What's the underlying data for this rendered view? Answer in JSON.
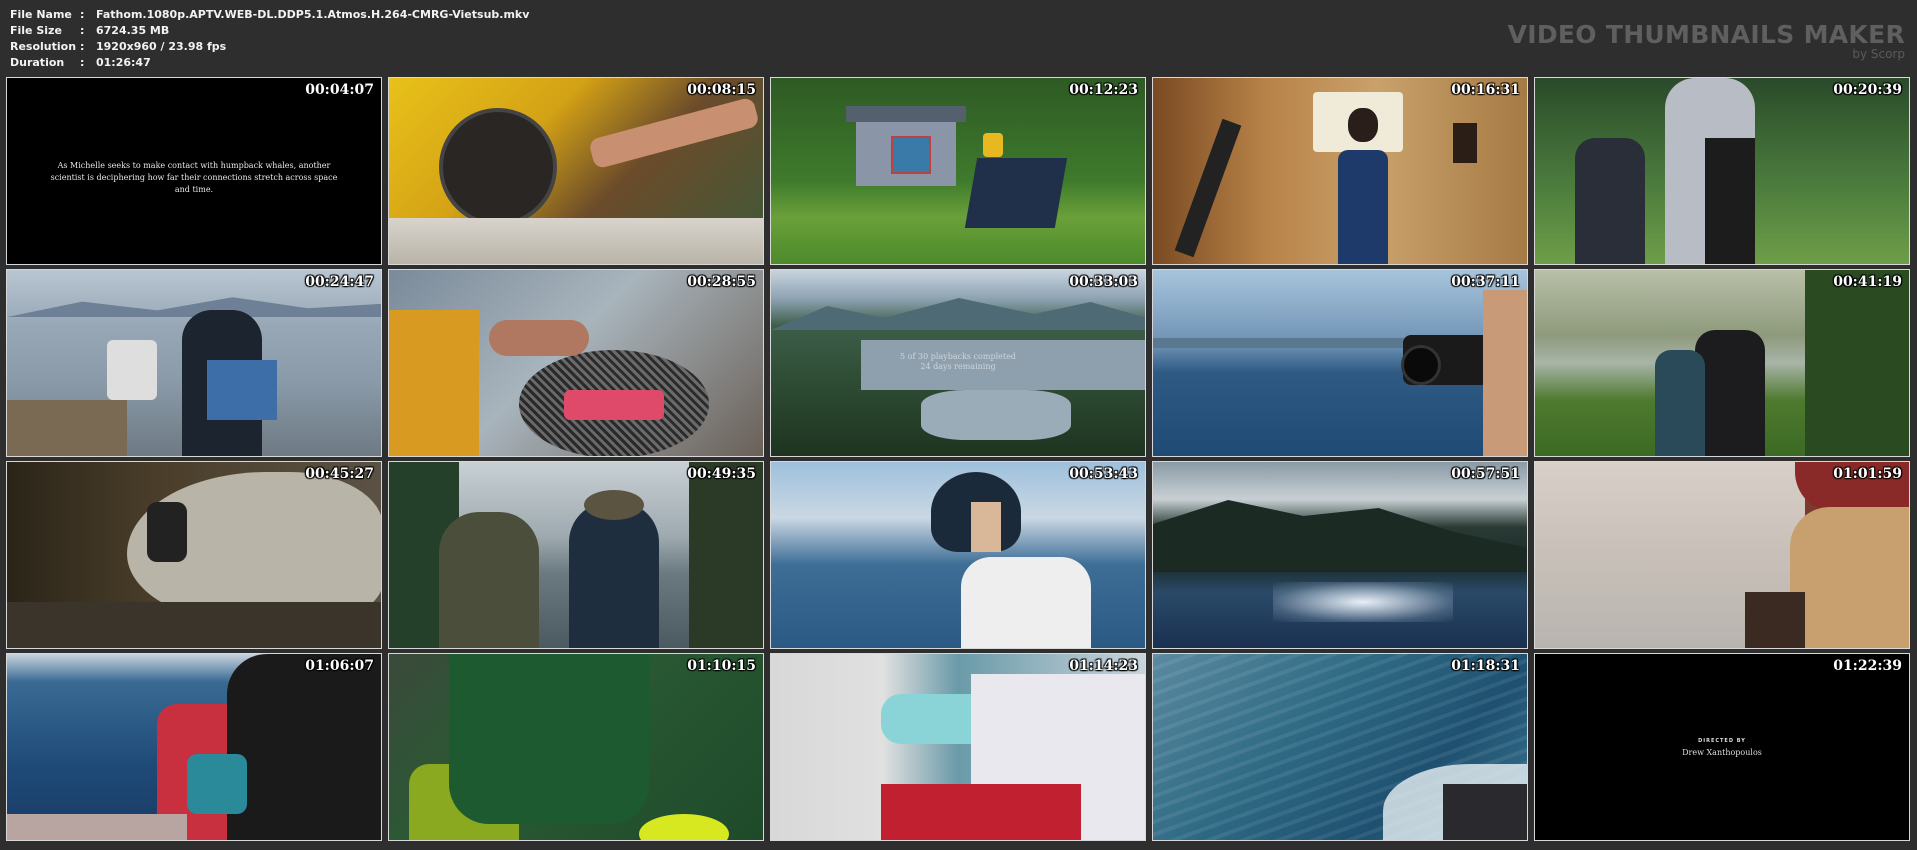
{
  "info": {
    "file_name_key": "File Name",
    "file_name": "Fathom.1080p.APTV.WEB-DL.DDP5.1.Atmos.H.264-CMRG-Vietsub.mkv",
    "file_size_key": "File Size",
    "file_size": "6724.35 MB",
    "resolution_key": "Resolution",
    "resolution": "1920x960 / 23.98 fps",
    "duration_key": "Duration",
    "duration": "01:26:47",
    "separator": ":"
  },
  "brand": {
    "title": "VIDEO THUMBNAILS MAKER",
    "subtitle": "by Scorp"
  },
  "thumbnails": [
    {
      "time": "00:04:07",
      "caption": "As Michelle seeks to make contact with humpback whales, another scientist is deciphering how far their connections stretch across space and time."
    },
    {
      "time": "00:08:15"
    },
    {
      "time": "00:12:23"
    },
    {
      "time": "00:16:31"
    },
    {
      "time": "00:20:39"
    },
    {
      "time": "00:24:47"
    },
    {
      "time": "00:28:55"
    },
    {
      "time": "00:33:03",
      "overlay_line1": "5 of 30 playbacks completed",
      "overlay_line2": "24 days remaining"
    },
    {
      "time": "00:37:11"
    },
    {
      "time": "00:41:19"
    },
    {
      "time": "00:45:27"
    },
    {
      "time": "00:49:35"
    },
    {
      "time": "00:53:43"
    },
    {
      "time": "00:57:51"
    },
    {
      "time": "01:01:59"
    },
    {
      "time": "01:06:07"
    },
    {
      "time": "01:10:15"
    },
    {
      "time": "01:14:23"
    },
    {
      "time": "01:18:31"
    },
    {
      "time": "01:22:39",
      "credit_label": "DIRECTED BY",
      "credit_name": "Drew Xanthopoulos"
    }
  ]
}
